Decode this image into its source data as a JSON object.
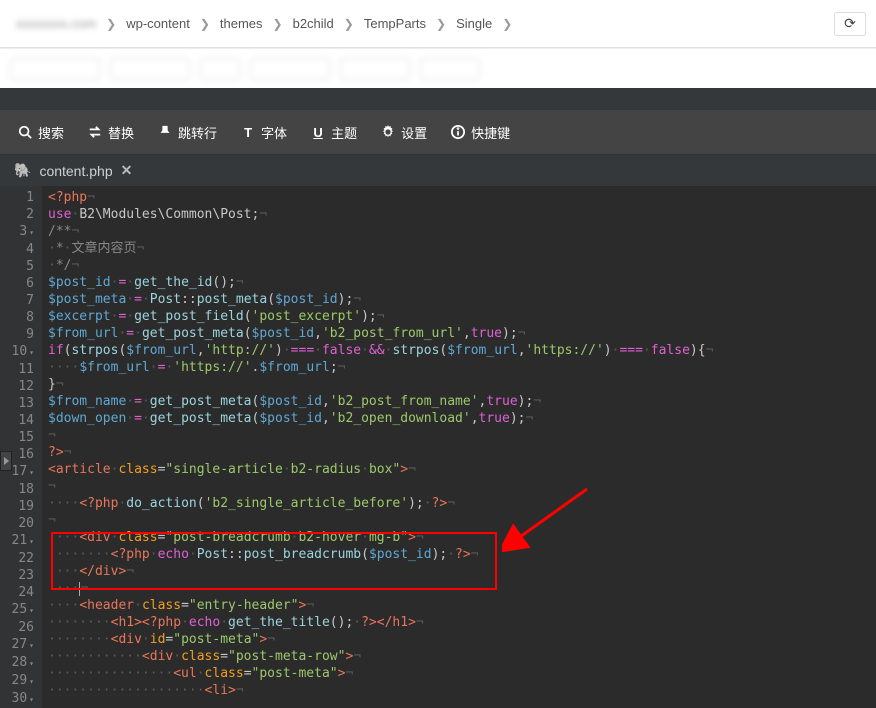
{
  "breadcrumb": {
    "items": [
      "wp-content",
      "themes",
      "b2child",
      "TempParts",
      "Single"
    ]
  },
  "toolbar": {
    "search": "搜索",
    "replace": "替换",
    "jump": "跳转行",
    "font": "字体",
    "theme": "主题",
    "settings": "设置",
    "shortcuts": "快捷键"
  },
  "tab": {
    "filename": "content.php"
  },
  "code": {
    "lines": [
      {
        "n": 1,
        "html": "<span class='k-tag'>&lt;?php</span><span class='inv'>¬</span>"
      },
      {
        "n": 2,
        "html": "<span class='k-key'>use</span><span class='inv'>·</span>B2\\Modules\\Common\\Post;<span class='inv'>¬</span>"
      },
      {
        "n": 3,
        "fold": "▾",
        "html": "<span class='k-cm'>/**</span><span class='inv'>¬</span>"
      },
      {
        "n": 4,
        "html": "<span class='k-cm'><span class='inv'>·</span>*<span class='inv'>·</span>文章内容页</span><span class='inv'>¬</span>"
      },
      {
        "n": 5,
        "html": "<span class='k-cm'><span class='inv'>·</span>*/</span><span class='inv'>¬</span>"
      },
      {
        "n": 6,
        "html": "<span class='k-var'>$post_id</span><span class='inv'>·</span><span class='k-key'>=</span><span class='inv'>·</span><span class='k-nm'>get_the_id</span>();<span class='inv'>¬</span>"
      },
      {
        "n": 7,
        "html": "<span class='k-var'>$post_meta</span><span class='inv'>·</span><span class='k-key'>=</span><span class='inv'>·</span><span class='k-nm'>Post</span>::<span class='k-nm'>post_meta</span>(<span class='k-var'>$post_id</span>);<span class='inv'>¬</span>"
      },
      {
        "n": 8,
        "html": "<span class='k-var'>$excerpt</span><span class='inv'>·</span><span class='k-key'>=</span><span class='inv'>·</span><span class='k-nm'>get_post_field</span>(<span class='k-str'>'post_excerpt'</span>);<span class='inv'>¬</span>"
      },
      {
        "n": 9,
        "html": "<span class='k-var'>$from_url</span><span class='inv'>·</span><span class='k-key'>=</span><span class='inv'>·</span><span class='k-nm'>get_post_meta</span>(<span class='k-var'>$post_id</span>,<span class='k-str'>'b2_post_from_url'</span>,<span class='k-key'>true</span>);<span class='inv'>¬</span>"
      },
      {
        "n": 10,
        "fold": "▾",
        "html": "<span class='k-key'>if</span>(<span class='k-nm'>strpos</span>(<span class='k-var'>$from_url</span>,<span class='k-str'>'http://'</span>)<span class='inv'>·</span><span class='k-key'>===</span><span class='inv'>·</span><span class='k-key'>false</span><span class='inv'>·</span><span class='k-key'>&amp;&amp;</span><span class='inv'>·</span><span class='k-nm'>strpos</span>(<span class='k-var'>$from_url</span>,<span class='k-str'>'https://'</span>)<span class='inv'>·</span><span class='k-key'>===</span><span class='inv'>·</span><span class='k-key'>false</span>){<span class='inv'>¬</span>"
      },
      {
        "n": 11,
        "html": "<span class='inv'>····</span><span class='k-var'>$from_url</span><span class='inv'>·</span><span class='k-key'>=</span><span class='inv'>·</span><span class='k-str'>'https://'</span>.<span class='k-var'>$from_url</span>;<span class='inv'>¬</span>"
      },
      {
        "n": 12,
        "html": "}<span class='inv'>¬</span>"
      },
      {
        "n": 13,
        "html": "<span class='k-var'>$from_name</span><span class='inv'>·</span><span class='k-key'>=</span><span class='inv'>·</span><span class='k-nm'>get_post_meta</span>(<span class='k-var'>$post_id</span>,<span class='k-str'>'b2_post_from_name'</span>,<span class='k-key'>true</span>);<span class='inv'>¬</span>"
      },
      {
        "n": 14,
        "html": "<span class='k-var'>$down_open</span><span class='inv'>·</span><span class='k-key'>=</span><span class='inv'>·</span><span class='k-nm'>get_post_meta</span>(<span class='k-var'>$post_id</span>,<span class='k-str'>'b2_open_download'</span>,<span class='k-key'>true</span>);<span class='inv'>¬</span>"
      },
      {
        "n": 15,
        "html": "<span class='inv'>¬</span>"
      },
      {
        "n": 16,
        "html": "<span class='k-tag'>?&gt;</span><span class='inv'>¬</span>"
      },
      {
        "n": 17,
        "fold": "▾",
        "html": "<span class='k-tag'>&lt;article</span><span class='inv'>·</span><span class='k-attr'>class</span>=<span class='k-str'>\"single-article<span class='inv'>·</span>b2-radius<span class='inv'>·</span>box\"</span><span class='k-tag'>&gt;</span><span class='inv'>¬</span>"
      },
      {
        "n": 18,
        "html": "<span class='inv'>¬</span>"
      },
      {
        "n": 19,
        "html": "<span class='inv'>····</span><span class='k-tag'>&lt;?php</span><span class='inv'>·</span><span class='k-nm'>do_action</span>(<span class='k-str'>'b2_single_article_before'</span>);<span class='inv'>·</span><span class='k-tag'>?&gt;</span><span class='inv'>¬</span>"
      },
      {
        "n": 20,
        "html": "<span class='inv'>¬</span>"
      },
      {
        "n": 21,
        "fold": "▾",
        "html": "<span class='inv'>····</span><span class='k-tag'>&lt;div</span><span class='inv'>·</span><span class='k-attr'>class</span>=<span class='k-str'>\"post-breadcrumb<span class='inv'>·</span>b2-hover<span class='inv'>·</span>mg-b\"</span><span class='k-tag'>&gt;</span><span class='inv'>¬</span>"
      },
      {
        "n": 22,
        "html": "<span class='inv'>········</span><span class='k-tag'>&lt;?php</span><span class='inv'>·</span><span class='k-key'>echo</span><span class='inv'>·</span><span class='k-nm'>Post</span>::<span class='k-nm'>post_breadcrumb</span>(<span class='k-var'>$post_id</span>);<span class='inv'>·</span><span class='k-tag'>?&gt;</span><span class='inv'>¬</span>"
      },
      {
        "n": 23,
        "html": "<span class='inv'>····</span><span class='k-tag'>&lt;/div&gt;</span><span class='inv'>¬</span>"
      },
      {
        "n": 24,
        "html": "<span class='inv'>····</span><span style='border-left:1px solid #aaa;display:inline-block;height:14px;vertical-align:middle'></span><span class='inv'>¬</span>"
      },
      {
        "n": 25,
        "fold": "▾",
        "html": "<span class='inv'>····</span><span class='k-tag'>&lt;header</span><span class='inv'>·</span><span class='k-attr'>class</span>=<span class='k-str'>\"entry-header\"</span><span class='k-tag'>&gt;</span><span class='inv'>¬</span>"
      },
      {
        "n": 26,
        "html": "<span class='inv'>········</span><span class='k-tag'>&lt;h1&gt;&lt;?php</span><span class='inv'>·</span><span class='k-key'>echo</span><span class='inv'>·</span><span class='k-nm'>get_the_title</span>();<span class='inv'>·</span><span class='k-tag'>?&gt;&lt;/h1&gt;</span><span class='inv'>¬</span>"
      },
      {
        "n": 27,
        "fold": "▾",
        "html": "<span class='inv'>········</span><span class='k-tag'>&lt;div</span><span class='inv'>·</span><span class='k-attr'>id</span>=<span class='k-str'>\"post-meta\"</span><span class='k-tag'>&gt;</span><span class='inv'>¬</span>"
      },
      {
        "n": 28,
        "fold": "▾",
        "html": "<span class='inv'>············</span><span class='k-tag'>&lt;div</span><span class='inv'>·</span><span class='k-attr'>class</span>=<span class='k-str'>\"post-meta-row\"</span><span class='k-tag'>&gt;</span><span class='inv'>¬</span>"
      },
      {
        "n": 29,
        "fold": "▾",
        "html": "<span class='inv'>················</span><span class='k-tag'>&lt;ul</span><span class='inv'>·</span><span class='k-attr'>class</span>=<span class='k-str'>\"post-meta\"</span><span class='k-tag'>&gt;</span><span class='inv'>¬</span>"
      },
      {
        "n": 30,
        "fold": "▾",
        "html": "<span class='inv'>····················</span><span class='k-tag'>&lt;li&gt;</span><span class='inv'>¬</span>"
      }
    ]
  }
}
